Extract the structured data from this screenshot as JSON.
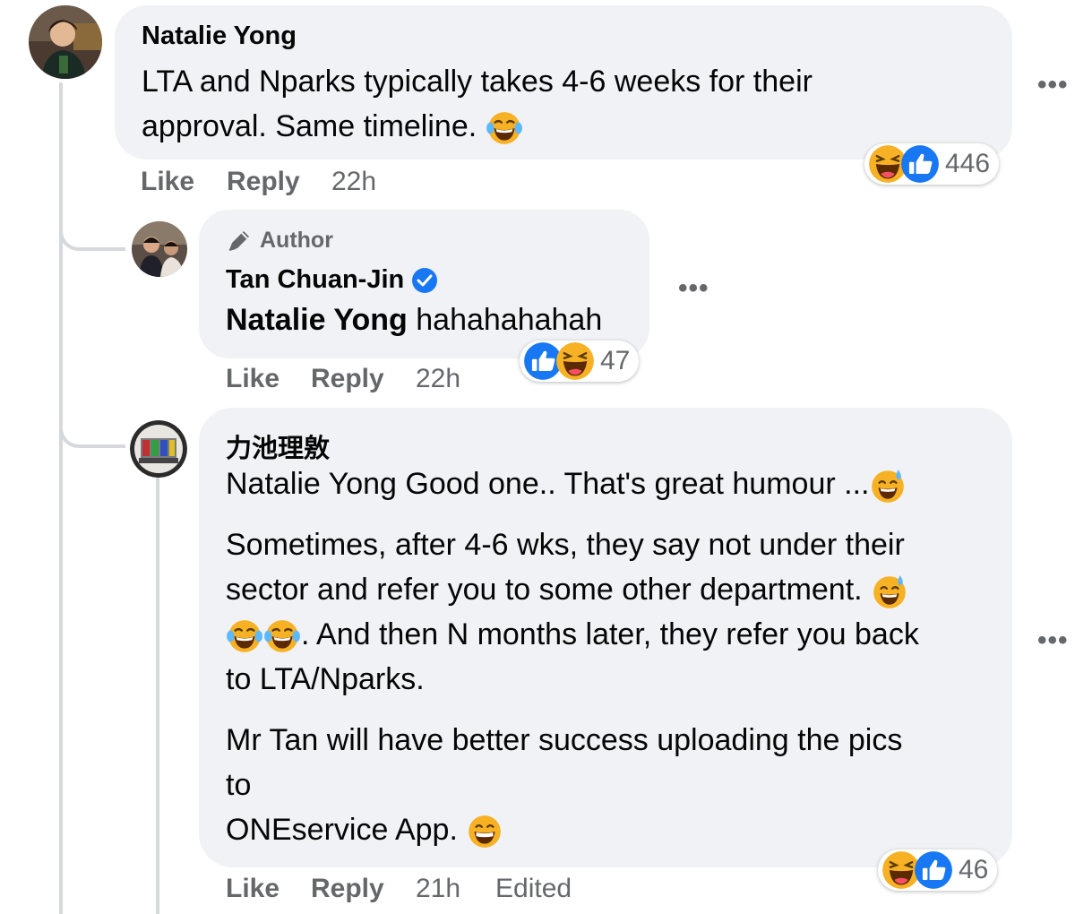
{
  "comments": {
    "c1": {
      "author": "Natalie Yong",
      "text_line1": "LTA and Nparks typically takes 4-6 weeks for their",
      "text_line2": "approval. Same timeline.",
      "reaction_count": "446",
      "like": "Like",
      "reply": "Reply",
      "time": "22h",
      "more": "•••"
    },
    "c2": {
      "badge": "Author",
      "author": "Tan Chuan-Jin",
      "mention": "Natalie Yong",
      "text": "hahahahahah",
      "reaction_count": "47",
      "like": "Like",
      "reply": "Reply",
      "time": "22h",
      "more": "•••"
    },
    "c3": {
      "author": "力池理敫",
      "mention": "Natalie Yong",
      "line1": "Good one.. That's great humour ...",
      "p2_line1": "Sometimes, after 4-6 wks, they say not under their",
      "p2_line2": "sector and refer you to some other department.",
      "p2_line3": ". And then N months later, they refer you back",
      "p2_line4": "to LTA/Nparks.",
      "p3_line1": "Mr Tan will have better success uploading the pics",
      "p3_line2": "to",
      "p3_line3": "ONEservice App.",
      "reaction_count": "46",
      "like": "Like",
      "reply": "Reply",
      "time": "21h",
      "edited": "Edited",
      "more": "•••"
    }
  },
  "colors": {
    "bubble": "#f0f2f5",
    "secondary_text": "#65676b",
    "like_blue": "#1877f2",
    "haha_yellow": "#f7b125",
    "verified_blue": "#1877f2"
  },
  "icons": {
    "haha": "haha-emoji-icon",
    "like": "like-thumb-icon",
    "verified": "verified-badge-icon",
    "author_badge": "pen-icon"
  }
}
